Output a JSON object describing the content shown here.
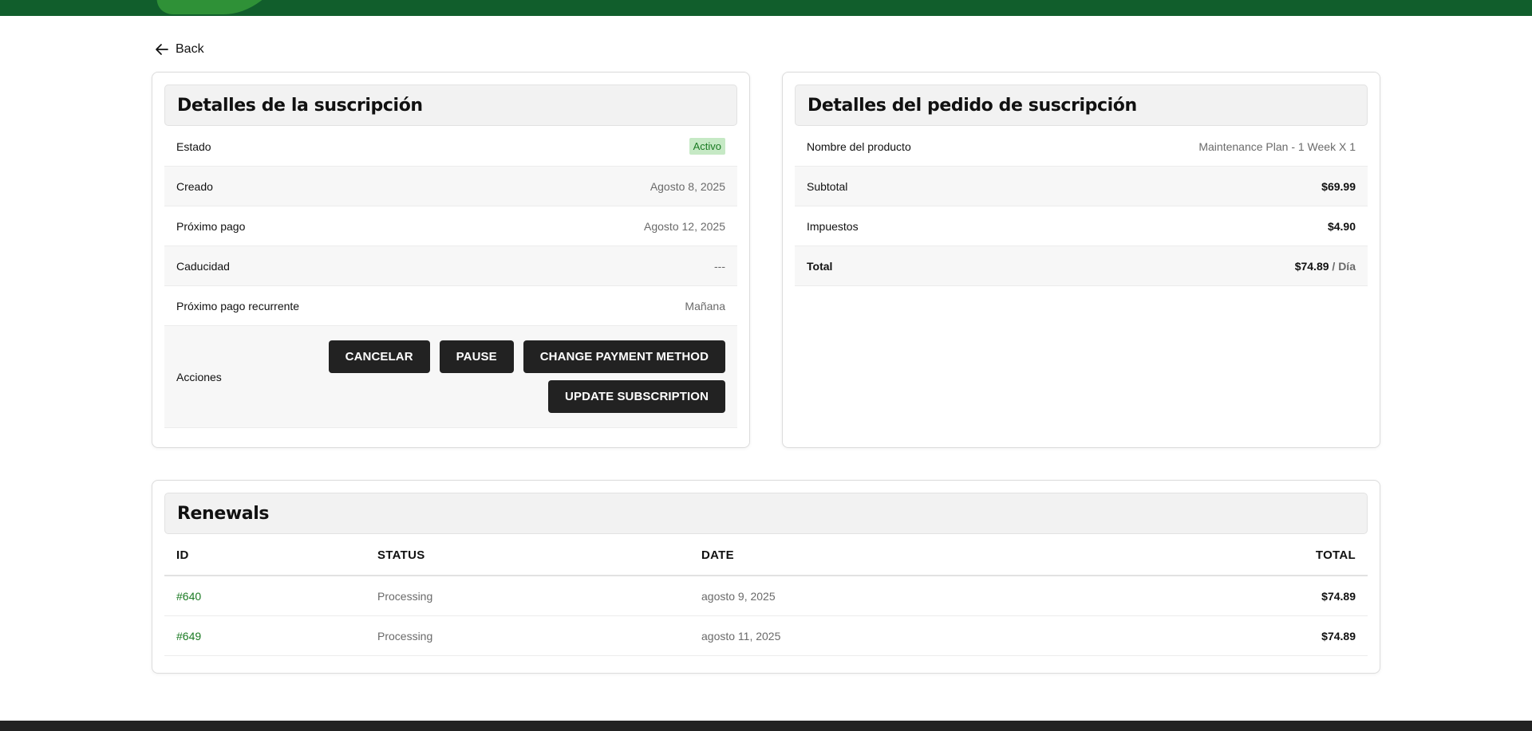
{
  "nav": {
    "back_label": "Back",
    "back_icon": "arrow-left-icon"
  },
  "colors": {
    "brand_green": "#115e2c",
    "accent_green": "#2f9137",
    "active_badge_bg": "#c6e9c5",
    "link_green": "#1a7a22",
    "button_dark": "#222222"
  },
  "subscription": {
    "title": "Detalles de la suscripción",
    "rows": [
      {
        "label": "Estado",
        "value": "Activo"
      },
      {
        "label": "Creado",
        "value": "Agosto 8, 2025"
      },
      {
        "label": "Próximo pago",
        "value": "Agosto 12, 2025"
      },
      {
        "label": "Caducidad",
        "value": "---"
      },
      {
        "label": "Próximo pago recurrente",
        "value": "Mañana"
      }
    ],
    "actions_label": "Acciones",
    "actions": {
      "cancel": "CANCELAR",
      "pause": "PAUSE",
      "change_payment": "CHANGE PAYMENT METHOD",
      "update": "UPDATE SUBSCRIPTION"
    }
  },
  "order": {
    "title": "Detalles del pedido de suscripción",
    "rows": [
      {
        "label": "Nombre del producto",
        "value": "Maintenance Plan - 1 Week X 1"
      },
      {
        "label": "Subtotal",
        "value": "$69.99"
      },
      {
        "label": "Impuestos",
        "value": "$4.90"
      },
      {
        "label": "Total",
        "value": "$74.89",
        "period": " / Día"
      }
    ]
  },
  "renewals": {
    "title": "Renewals",
    "columns": [
      "ID",
      "STATUS",
      "DATE",
      "TOTAL"
    ],
    "rows": [
      {
        "id": "#640",
        "status": "Processing",
        "date": "agosto 9, 2025",
        "total": "$74.89"
      },
      {
        "id": "#649",
        "status": "Processing",
        "date": "agosto 11, 2025",
        "total": "$74.89"
      }
    ]
  }
}
